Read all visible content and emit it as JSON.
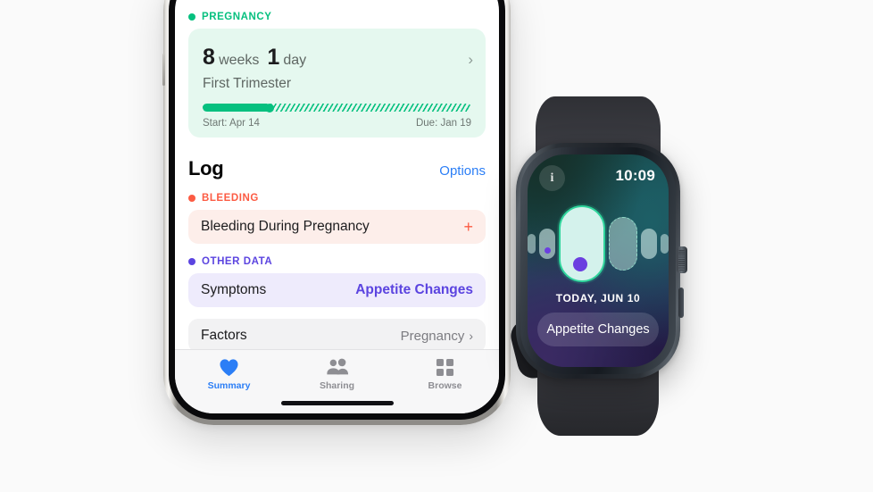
{
  "scene": {
    "background": "#fafafa"
  },
  "phone": {
    "app": "Health",
    "sections": {
      "pregnancy": {
        "label": "PREGNANCY",
        "dot_color": "#06c07f",
        "card": {
          "weeks_value": "8",
          "weeks_unit": "weeks",
          "days_value": "1",
          "days_unit": "day",
          "trimester": "First Trimester",
          "progress_percent": 25,
          "start_label": "Start: Apr 14",
          "due_label": "Due: Jan 19",
          "chevron": "›",
          "background": "#e5f8ef",
          "accent": "#06c07f"
        }
      },
      "log": {
        "title": "Log",
        "options_label": "Options",
        "options_color": "#2b7ef6"
      },
      "bleeding": {
        "label": "BLEEDING",
        "dot_color": "#fc5b43",
        "row": {
          "title": "Bleeding During Pregnancy",
          "action": "+",
          "background": "#fdeeea",
          "accent": "#fc5b43"
        }
      },
      "other_data": {
        "label": "OTHER DATA",
        "dot_color": "#5b44e0",
        "symptoms_row": {
          "title": "Symptoms",
          "value": "Appetite Changes",
          "background": "#eeebfc",
          "accent": "#5b44e0"
        },
        "factors_row": {
          "title": "Factors",
          "value": "Pregnancy",
          "chevron": "›",
          "background": "#f2f2f3"
        }
      }
    },
    "tabbar": [
      {
        "label": "Summary",
        "icon": "heart-icon",
        "active": true
      },
      {
        "label": "Sharing",
        "icon": "people-icon",
        "active": false
      },
      {
        "label": "Browse",
        "icon": "grid-icon",
        "active": false
      }
    ]
  },
  "watch": {
    "info_glyph": "i",
    "time": "10:09",
    "today_label": "TODAY, JUN 10",
    "button_label": "Appetite Changes",
    "cycle_pills": [
      {
        "size": "tiny",
        "dot": false,
        "style": "solid"
      },
      {
        "size": "small",
        "dot": true,
        "style": "solid"
      },
      {
        "size": "today",
        "dot": true,
        "style": "solid"
      },
      {
        "size": "med",
        "dot": false,
        "style": "dashed"
      },
      {
        "size": "small",
        "dot": false,
        "style": "solid"
      },
      {
        "size": "tiny",
        "dot": false,
        "style": "solid"
      }
    ],
    "colors": {
      "highlight_ring": "#2fd59c",
      "symptom_dot": "#6b3fe0",
      "case": "#1c2026"
    }
  }
}
